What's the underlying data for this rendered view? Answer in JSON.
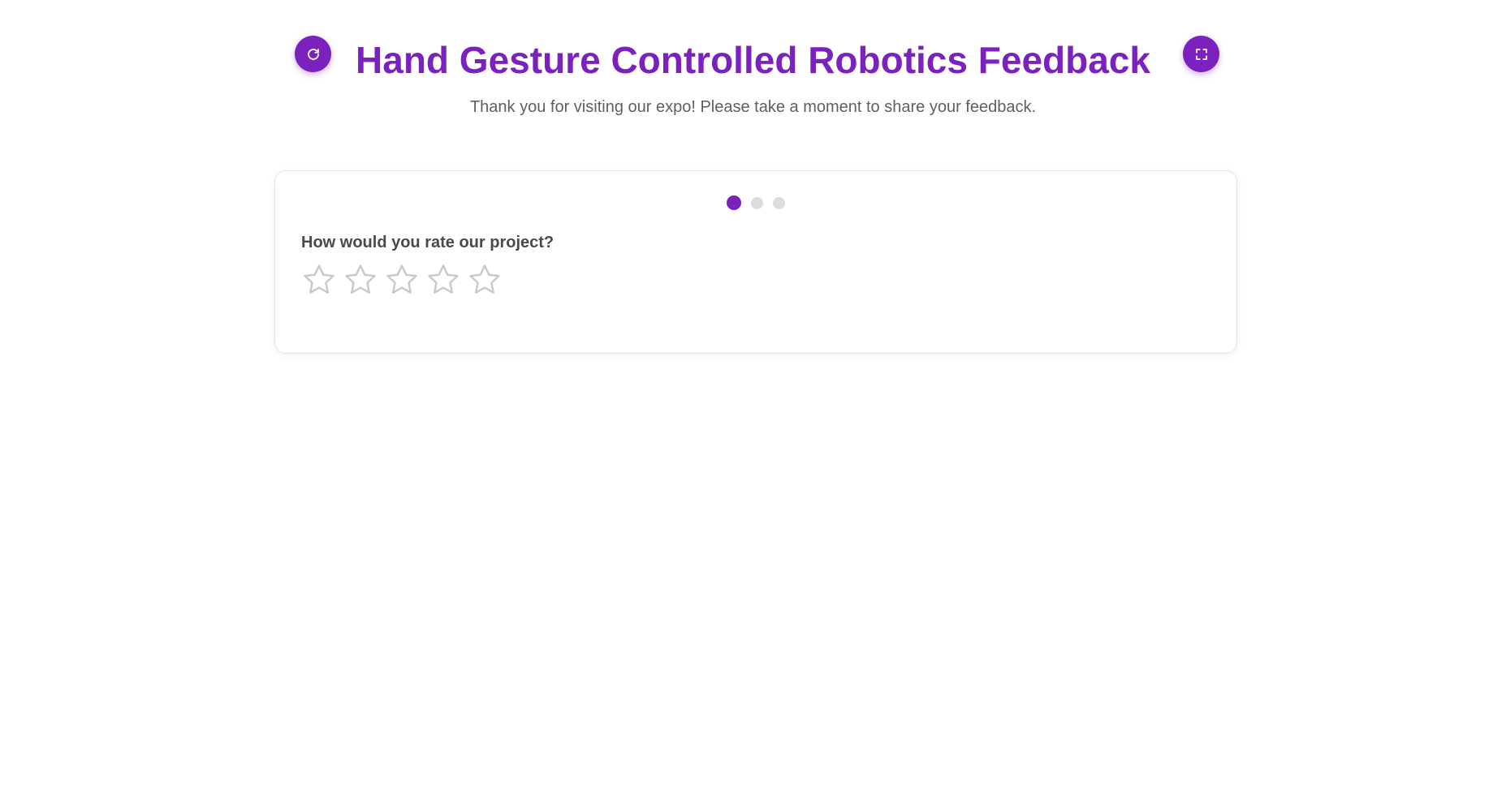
{
  "header": {
    "title": "Hand Gesture Controlled Robotics Feedback",
    "subtitle": "Thank you for visiting our expo! Please take a moment to share your feedback.",
    "refresh_icon": "refresh-icon",
    "fullscreen_icon": "fullscreen-icon"
  },
  "card": {
    "steps_total": 3,
    "current_step": 1,
    "question": "How would you rate our project?",
    "rating": {
      "max": 5,
      "value": 0
    }
  },
  "colors": {
    "accent": "#7b22be",
    "inactive_dot": "#dcdcdc",
    "star_outline": "#c8c8c8"
  }
}
